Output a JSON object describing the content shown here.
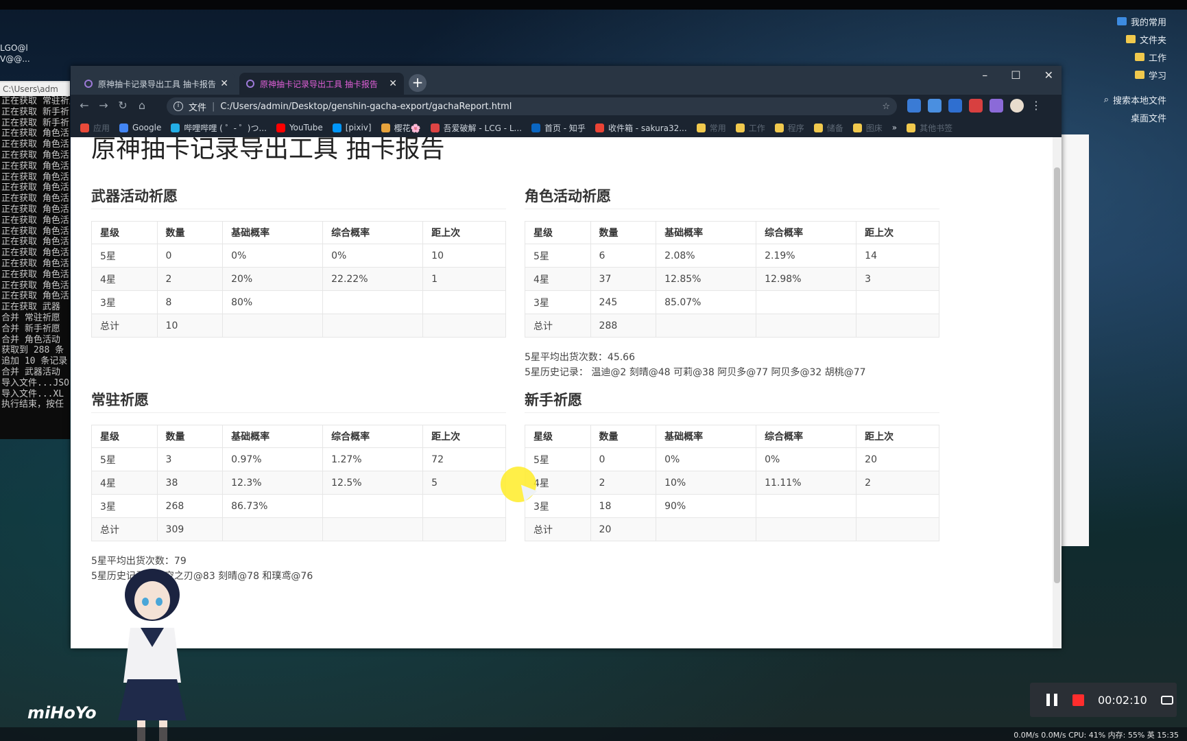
{
  "desktop": {
    "left_labels": [
      "LGO@l",
      "V@@..."
    ],
    "right_items": [
      {
        "label": "我的常用",
        "icon": "blue"
      },
      {
        "label": "文件夹",
        "icon": "folder"
      },
      {
        "label": "工作",
        "icon": "folder"
      },
      {
        "label": "学习",
        "icon": "folder"
      },
      {
        "label": "搜索本地文件",
        "icon": "search"
      },
      {
        "label": "桌面文件",
        "icon": "none"
      }
    ]
  },
  "console": {
    "title": "C:\\Users\\adm",
    "lines": [
      "正在获取 常驻祈愿",
      "正在获取 新手祈",
      "正在获取 新手祈",
      "正在获取 角色活",
      "正在获取 角色活",
      "正在获取 角色活",
      "正在获取 角色活",
      "正在获取 角色活",
      "正在获取 角色活",
      "正在获取 角色活",
      "正在获取 角色活",
      "正在获取 角色活",
      "正在获取 角色活",
      "正在获取 角色活",
      "正在获取 角色活",
      "正在获取 角色活",
      "正在获取 角色活",
      "正在获取 角色活",
      "正在获取 角色活",
      "正在获取 武器",
      "合并 常驻祈愿",
      "合并 新手祈愿",
      "合并 角色活动",
      "获取到 288 条",
      "追加 10 条记录",
      "合并 武器活动",
      "导入文件...JSO",
      "导入文件...XL",
      "执行结束，按任"
    ]
  },
  "browser": {
    "tabs": [
      {
        "label": "原神抽卡记录导出工具 抽卡报告",
        "active": false
      },
      {
        "label": "原神抽卡记录导出工具 抽卡报告",
        "active": true
      }
    ],
    "new_tab": "+",
    "window_controls": [
      "–",
      "☐",
      "✕"
    ],
    "address": {
      "scheme_label": "文件",
      "url": "C:/Users/admin/Desktop/genshin-gacha-export/gachaReport.html"
    },
    "bookmarks": [
      {
        "label": "应用",
        "dim": true,
        "color": "#e94a3a"
      },
      {
        "label": "Google",
        "dim": false,
        "color": "#4285f4"
      },
      {
        "label": "哔哩哔哩 ( ゜- ゜)つ...",
        "dim": false,
        "color": "#23ade5"
      },
      {
        "label": "YouTube",
        "dim": false,
        "color": "#ff0000"
      },
      {
        "label": "[pixiv]",
        "dim": false,
        "color": "#0096fa"
      },
      {
        "label": "樱花🌸",
        "dim": false,
        "color": "#e7a33c"
      },
      {
        "label": "吾爱破解 - LCG - L...",
        "dim": false,
        "color": "#d44"
      },
      {
        "label": "首页 - 知乎",
        "dim": false,
        "color": "#0a66c2"
      },
      {
        "label": "收件箱 - sakura32...",
        "dim": false,
        "color": "#ea4335"
      },
      {
        "label": "常用",
        "dim": true,
        "color": "#f1c94d"
      },
      {
        "label": "工作",
        "dim": true,
        "color": "#f1c94d"
      },
      {
        "label": "程序",
        "dim": true,
        "color": "#f1c94d"
      },
      {
        "label": "储备",
        "dim": true,
        "color": "#f1c94d"
      },
      {
        "label": "图床",
        "dim": true,
        "color": "#f1c94d"
      },
      {
        "label": "»",
        "dim": false,
        "color": ""
      },
      {
        "label": "其他书签",
        "dim": true,
        "color": "#f1c94d"
      }
    ]
  },
  "page": {
    "title": "原神抽卡记录导出工具 抽卡报告",
    "headers": [
      "星级",
      "数量",
      "基础概率",
      "综合概率",
      "距上次"
    ],
    "sections": [
      {
        "title": "武器活动祈愿",
        "rows": [
          [
            "5星",
            "0",
            "0%",
            "0%",
            "10"
          ],
          [
            "4星",
            "2",
            "20%",
            "22.22%",
            "1"
          ],
          [
            "3星",
            "8",
            "80%",
            "",
            ""
          ],
          [
            "总计",
            "10",
            "",
            "",
            ""
          ]
        ],
        "avg": "",
        "history": ""
      },
      {
        "title": "角色活动祈愿",
        "rows": [
          [
            "5星",
            "6",
            "2.08%",
            "2.19%",
            "14"
          ],
          [
            "4星",
            "37",
            "12.85%",
            "12.98%",
            "3"
          ],
          [
            "3星",
            "245",
            "85.07%",
            "",
            ""
          ],
          [
            "总计",
            "288",
            "",
            "",
            ""
          ]
        ],
        "avg": "5星平均出货次数：45.66",
        "history": "5星历史记录：  温迪@2  刻晴@48  可莉@38  阿贝多@77  阿贝多@32  胡桃@77"
      },
      {
        "title": "常驻祈愿",
        "rows": [
          [
            "5星",
            "3",
            "0.97%",
            "1.27%",
            "72"
          ],
          [
            "4星",
            "38",
            "12.3%",
            "12.5%",
            "5"
          ],
          [
            "3星",
            "268",
            "86.73%",
            "",
            ""
          ],
          [
            "总计",
            "309",
            "",
            "",
            ""
          ]
        ],
        "avg": "5星平均出货次数：79",
        "history": "5星历史记录：天空之刃@83  刻晴@78  和璞鸢@76"
      },
      {
        "title": "新手祈愿",
        "rows": [
          [
            "5星",
            "0",
            "0%",
            "0%",
            "20"
          ],
          [
            "4星",
            "2",
            "10%",
            "11.11%",
            "2"
          ],
          [
            "3星",
            "18",
            "90%",
            "",
            ""
          ],
          [
            "总计",
            "20",
            "",
            "",
            ""
          ]
        ],
        "avg": "",
        "history": ""
      }
    ]
  },
  "overlay": {
    "brand": "miHoYo",
    "recorder_time": "00:02:10",
    "taskbar_status": "0.0M/s  0.0M/s  CPU: 41%  内存: 55%    英   15:35"
  }
}
